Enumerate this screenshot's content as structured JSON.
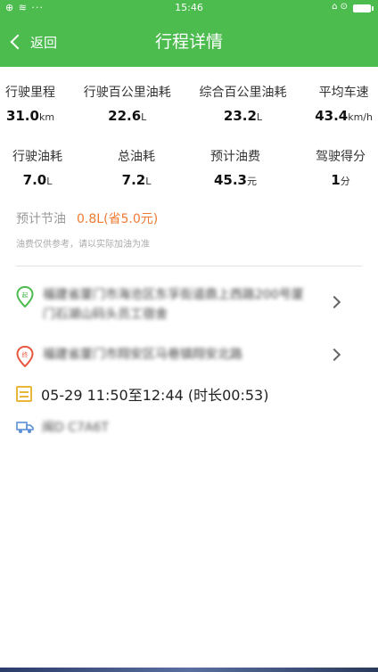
{
  "status_bar": {
    "left": "⊕ ≋ ···",
    "time": "15:46",
    "right": "⌂ ⊙"
  },
  "header": {
    "back_label": "返回",
    "title": "行程详情",
    "color": "#4cbc4f"
  },
  "stats": {
    "row1": [
      {
        "label": "行驶里程",
        "value": "31.0",
        "unit": "km"
      },
      {
        "label": "行驶百公里油耗",
        "value": "22.6",
        "unit": "L"
      },
      {
        "label": "综合百公里油耗",
        "value": "23.2",
        "unit": "L"
      },
      {
        "label": "平均车速",
        "value": "43.4",
        "unit": "km/h"
      }
    ],
    "row2": [
      {
        "label": "行驶油耗",
        "value": "7.0",
        "unit": "L"
      },
      {
        "label": "总油耗",
        "value": "7.2",
        "unit": "L"
      },
      {
        "label": "预计油费",
        "value": "45.3",
        "unit": "元"
      },
      {
        "label": "驾驶得分",
        "value": "1",
        "unit": "分"
      }
    ]
  },
  "saving": {
    "label": "预计节油",
    "value": "0.8L(省5.0元)",
    "color": "#f07a32"
  },
  "note": "油费仅供参考，请以实际加油为准",
  "trip": {
    "start_address": "福建省厦门市海沧区东孚街道鼎上西路200号厦门石湖山码头员工宿舍",
    "start_icon": "start-pin-icon",
    "end_address": "福建省厦门市翔安区马巷镇翔安北路",
    "end_icon": "end-pin-icon",
    "time": "05-29 11:50至12:44 (时长00:53)",
    "plate": "闽D C7A6T"
  }
}
